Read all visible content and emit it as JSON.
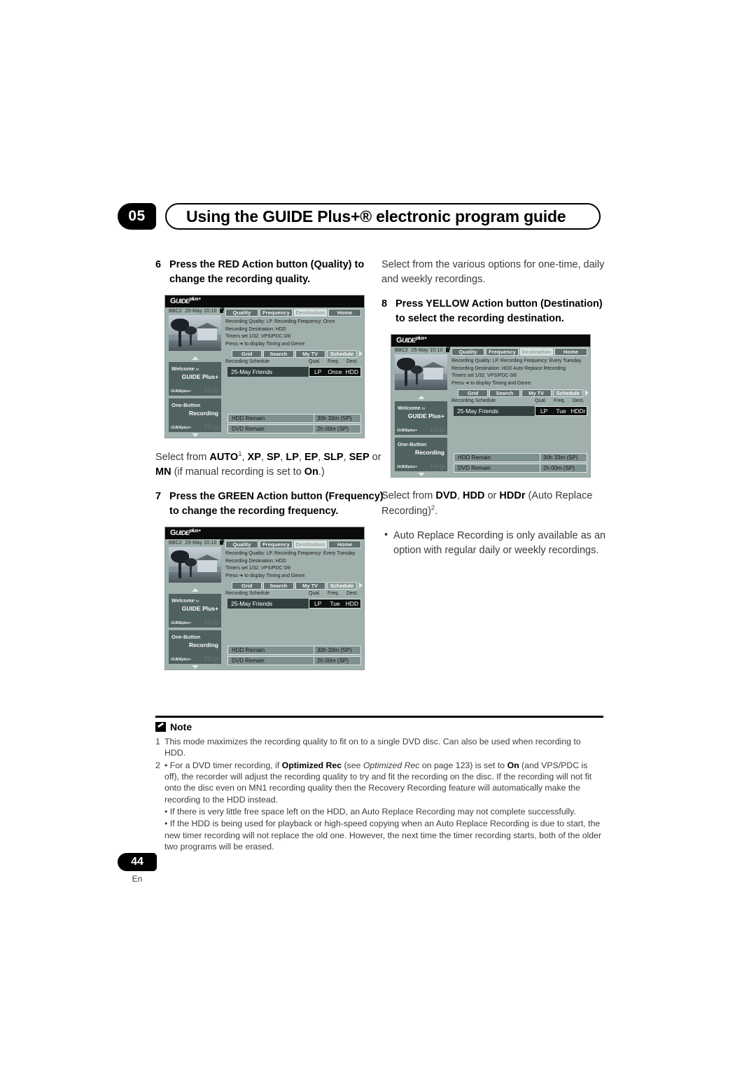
{
  "header": {
    "chapter": "05",
    "title": "Using the GUIDE Plus+® electronic program guide"
  },
  "left_column": {
    "step6": {
      "number": "6",
      "text": "Press the RED Action button (Quality) to change the recording quality."
    },
    "after_step6": {
      "prefix": "Select from ",
      "b1": "AUTO",
      "sup1": "1",
      "mid1": ", ",
      "b2": "XP",
      "mid2": ", ",
      "b3": "SP",
      "mid3": ", ",
      "b4": "LP",
      "mid4": ", ",
      "b5": "EP",
      "mid5": ", ",
      "b6": "SLP",
      "mid6": ", ",
      "b7": "SEP",
      "mid7": " or ",
      "b8": "MN",
      "mid8": " (if manual recording is set to ",
      "b9": "On",
      "suffix": ".)"
    },
    "step7": {
      "number": "7",
      "text": "Press the GREEN Action button (Frequency) to change the recording frequency."
    }
  },
  "right_column": {
    "intro": "Select from the various options for one-time, daily and weekly recordings.",
    "step8": {
      "number": "8",
      "text": "Press YELLOW Action button (Destination) to select the recording destination."
    },
    "after_step8": {
      "prefix": "Select from ",
      "b1": "DVD",
      "mid1": ", ",
      "b2": "HDD",
      "mid2": " or ",
      "b3": "HDDr",
      "mid3": " (Auto Replace Recording)",
      "sup": "2",
      "suffix": "."
    },
    "bullets": [
      "Auto Replace Recording is only available as an option with regular daily or weekly recordings."
    ]
  },
  "screenshots": [
    {
      "id": "quality-screen",
      "logo": "GUIDE Plus+",
      "channel": "BBC2",
      "date": "25-May",
      "time": "10:10",
      "tabs": [
        {
          "label": "Quality",
          "selected": false
        },
        {
          "label": "Frequency",
          "selected": false
        },
        {
          "label": "Destination",
          "selected": true
        },
        {
          "label": "Home",
          "selected": false
        }
      ],
      "info_lines": [
        "Recording Quality: LP. Recording Frequency: Once",
        "Recording Destination: HDD",
        "Timers set 1/32. VPS/PDC 0/8",
        "Press ➜ to display Timing and Genre"
      ],
      "subtabs": [
        {
          "label": "Grid",
          "selected": false
        },
        {
          "label": "Search",
          "selected": false
        },
        {
          "label": "My TV",
          "selected": false
        },
        {
          "label": "Schedule",
          "selected": true
        }
      ],
      "schedule_header": {
        "label": "Recording Schedule",
        "col_qual": "Qual.",
        "col_freq": "Freq.",
        "col_dest": "Dest."
      },
      "schedule_row": {
        "title": "25-May  Friends",
        "qual": "LP",
        "freq": "Once",
        "dest": "HDD"
      },
      "panels": {
        "welcome_l1": "Welcome",
        "welcome_l1_small": "to",
        "welcome_l2": "GUIDE Plus+",
        "onebutton_l1": "One-Button",
        "onebutton_l2": "Recording",
        "watermark": "Help",
        "panel_logo": "GUIDEplus+"
      },
      "remain": [
        {
          "label": "HDD Remain",
          "value": "30h 33m (SP)"
        },
        {
          "label": "DVD Remain",
          "value": "2h 00m (SP)"
        }
      ]
    },
    {
      "id": "frequency-screen",
      "logo": "GUIDE Plus+",
      "channel": "BBC2",
      "date": "25-May",
      "time": "10:10",
      "tabs": [
        {
          "label": "Quality",
          "selected": false
        },
        {
          "label": "Frequency",
          "selected": false
        },
        {
          "label": "Destination",
          "selected": true
        },
        {
          "label": "Home",
          "selected": false
        }
      ],
      "info_lines": [
        "Recording Quality: LP. Recording Frequency: Every Tuesday",
        "Recording Destination: HDD",
        "Timers set 1/32. VPS/PDC 0/8",
        "Press ➜ to display Timing and Genre."
      ],
      "subtabs": [
        {
          "label": "Grid",
          "selected": false
        },
        {
          "label": "Search",
          "selected": false
        },
        {
          "label": "My TV",
          "selected": false
        },
        {
          "label": "Schedule",
          "selected": true
        }
      ],
      "schedule_header": {
        "label": "Recording Schedule",
        "col_qual": "Qual.",
        "col_freq": "Freq.",
        "col_dest": "Dest."
      },
      "schedule_row": {
        "title": "25-May  Friends",
        "qual": "LP",
        "freq": "Tue",
        "dest": "HDD"
      },
      "panels": {
        "welcome_l1": "Welcome",
        "welcome_l1_small": "to",
        "welcome_l2": "GUIDE Plus+",
        "onebutton_l1": "One-Button",
        "onebutton_l2": "Recording",
        "watermark": "Help",
        "panel_logo": "GUIDEplus+"
      },
      "remain": [
        {
          "label": "HDD Remain",
          "value": "30h 33m (SP)"
        },
        {
          "label": "DVD Remain",
          "value": "2h 00m (SP)"
        }
      ]
    },
    {
      "id": "destination-screen",
      "logo": "GUIDE Plus+",
      "channel": "BBC2",
      "date": "25-May",
      "time": "10:10",
      "tabs": [
        {
          "label": "Quality",
          "selected": false
        },
        {
          "label": "Frequency",
          "selected": false
        },
        {
          "label": "Destination",
          "selected": true
        },
        {
          "label": "Home",
          "selected": false
        }
      ],
      "info_lines": [
        "Recording Quality: LP. Recording Frequency: Every Tuesday",
        "Recording Destination: HDD Auto Replace Recording",
        "Timers set 1/32. VPS/PDC 0/8",
        "Press ➜ to display Timing and Genre."
      ],
      "subtabs": [
        {
          "label": "Grid",
          "selected": false
        },
        {
          "label": "Search",
          "selected": false
        },
        {
          "label": "My TV",
          "selected": false
        },
        {
          "label": "Schedule",
          "selected": true
        }
      ],
      "schedule_header": {
        "label": "Recording Schedule",
        "col_qual": "Qual.",
        "col_freq": "Freq.",
        "col_dest": "Dest."
      },
      "schedule_row": {
        "title": "25-May  Friends",
        "qual": "LP",
        "freq": "Tue",
        "dest": "HDDr"
      },
      "panels": {
        "welcome_l1": "Welcome",
        "welcome_l1_small": "to",
        "welcome_l2": "GUIDE Plus+",
        "onebutton_l1": "One-Button",
        "onebutton_l2": "Recording",
        "watermark": "Help",
        "panel_logo": "GUIDEplus+"
      },
      "remain": [
        {
          "label": "HDD Remain",
          "value": "30h 33m (SP)"
        },
        {
          "label": "DVD Remain",
          "value": "2h 00m (SP)"
        }
      ]
    }
  ],
  "note": {
    "label": "Note",
    "items": [
      {
        "number": "1",
        "parts": [
          {
            "t": "This mode maximizes the recording quality to fit on to a single DVD disc. Can also be used when recording to HDD.",
            "style": "normal"
          }
        ]
      },
      {
        "number": "2",
        "parts": [
          {
            "t": "• For a DVD timer recording, if ",
            "style": "normal"
          },
          {
            "t": "Optimized Rec",
            "style": "bold"
          },
          {
            "t": " (see ",
            "style": "normal"
          },
          {
            "t": "Optimized Rec",
            "style": "italic"
          },
          {
            "t": " on page 123) is set to ",
            "style": "normal"
          },
          {
            "t": "On",
            "style": "bold"
          },
          {
            "t": " (and VPS/PDC is off), the recorder will adjust the recording quality to try and fit the recording on the disc. If the recording will not fit onto the disc even on MN1 recording quality then the Recovery Recording feature will automatically make the recording to the HDD instead.",
            "style": "normal"
          }
        ]
      },
      {
        "number": "",
        "parts": [
          {
            "t": "• If there is very little free space left on the HDD, an Auto Replace Recording may not complete successfully.",
            "style": "normal"
          }
        ]
      },
      {
        "number": "",
        "parts": [
          {
            "t": "• If the HDD is being used for playback or high-speed copying when an Auto Replace Recording is due to start, the new timer recording will not replace the old one. However, the next time the timer recording starts, both of the older two programs will be erased.",
            "style": "normal"
          }
        ]
      }
    ]
  },
  "footer": {
    "page_number": "44",
    "language": "En"
  }
}
